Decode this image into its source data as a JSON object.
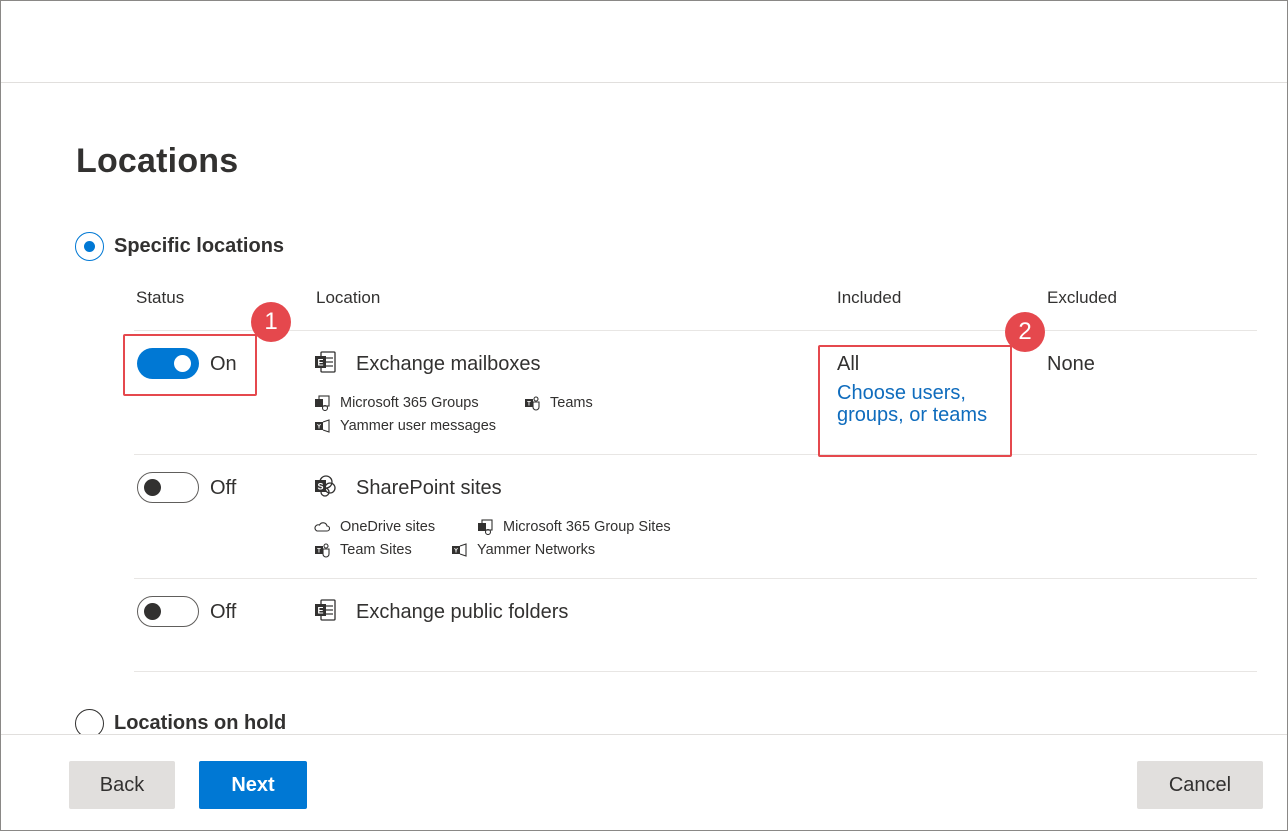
{
  "title": "Locations",
  "options": {
    "specific": "Specific locations",
    "on_hold": "Locations on hold"
  },
  "columns": {
    "status": "Status",
    "location": "Location",
    "included": "Included",
    "excluded": "Excluded"
  },
  "rows": [
    {
      "status": "On",
      "name": "Exchange mailboxes",
      "subs": [
        "Microsoft 365 Groups",
        "Teams",
        "Yammer user messages"
      ],
      "included": "All",
      "included_link": "Choose users, groups, or teams",
      "excluded": "None"
    },
    {
      "status": "Off",
      "name": "SharePoint sites",
      "subs": [
        "OneDrive sites",
        "Microsoft 365 Group Sites",
        "Team Sites",
        "Yammer Networks"
      ]
    },
    {
      "status": "Off",
      "name": "Exchange public folders",
      "subs": []
    }
  ],
  "callouts": [
    "1",
    "2"
  ],
  "buttons": {
    "back": "Back",
    "next": "Next",
    "cancel": "Cancel"
  },
  "colors": {
    "accent": "#0078d4",
    "link": "#0f6cbd",
    "callout": "#e5484d"
  },
  "icons": {
    "exchange": "exchange-icon",
    "sharepoint": "sharepoint-icon",
    "groups": "groups-icon",
    "teams": "teams-icon",
    "yammer": "yammer-icon",
    "onedrive": "onedrive-icon"
  }
}
